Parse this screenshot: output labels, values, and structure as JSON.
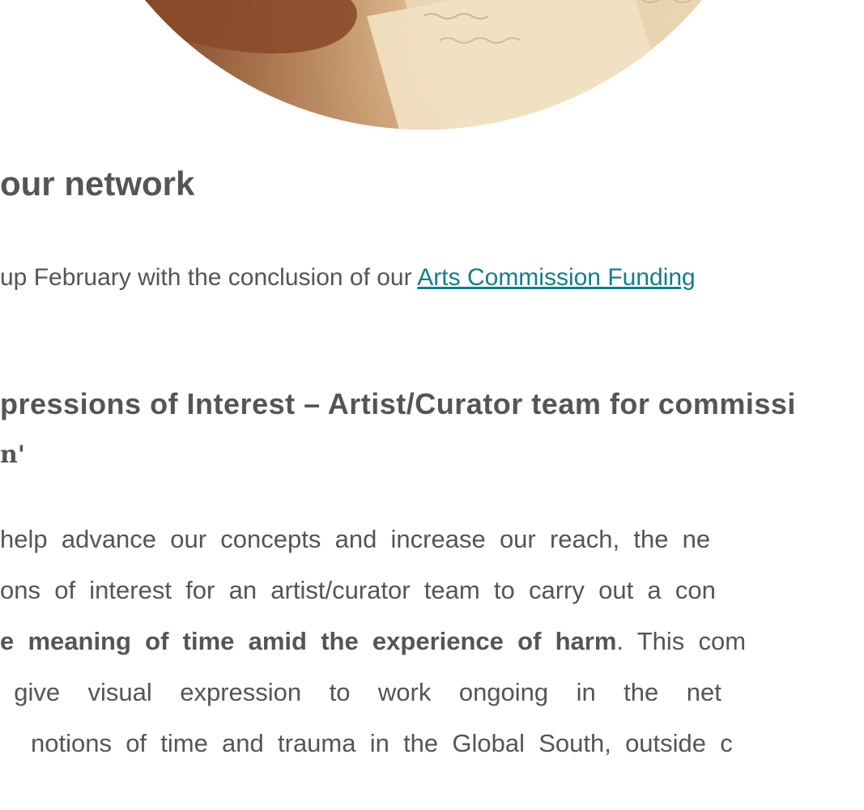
{
  "hero": {
    "image_description": "photo-notebook-writing"
  },
  "section": {
    "heading": "our network"
  },
  "intro": {
    "text_before": "up February with the conclusion of our ",
    "link_text": "Arts Commission Funding"
  },
  "subheading": {
    "text": "pressions of Interest – Artist/Curator team for commissi",
    "tail": "n'"
  },
  "body": {
    "line1": "help  advance  our  concepts  and  increase  our  reach,  the  ne",
    "line2": "ons  of  interest  for  an  artist/curator  team  to  carry  out  a  con",
    "line3_bold": "e  meaning  of  time  amid  the  experience  of  harm",
    "line3_rest": ".  This  com",
    "line4": "  give    visual    expression    to    work    ongoing    in    the    net",
    "line5": "notions  of  time  and  trauma  in  the  Global  South,  outside  c"
  },
  "colors": {
    "text": "#555555",
    "link": "#127e8a",
    "background": "#ffffff"
  }
}
